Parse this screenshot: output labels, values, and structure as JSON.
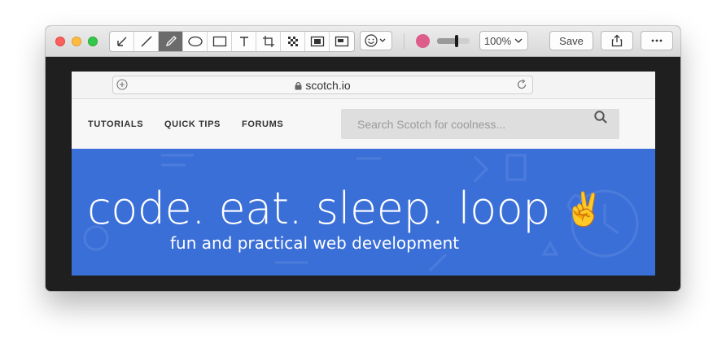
{
  "toolbar": {
    "tools": [
      {
        "name": "arrow-tool",
        "icon": "arrow-icon"
      },
      {
        "name": "line-tool",
        "icon": "line-icon"
      },
      {
        "name": "pen-tool",
        "icon": "pen-icon",
        "active": true
      },
      {
        "name": "ellipse-tool",
        "icon": "ellipse-icon"
      },
      {
        "name": "rectangle-tool",
        "icon": "rectangle-icon"
      },
      {
        "name": "text-tool",
        "icon": "text-icon"
      },
      {
        "name": "crop-tool",
        "icon": "crop-icon"
      },
      {
        "name": "pixelate-tool",
        "icon": "pixelate-icon"
      },
      {
        "name": "highlight-tool",
        "icon": "highlight-icon"
      },
      {
        "name": "magnify-tool",
        "icon": "magnify-icon"
      }
    ],
    "emoji_icon": "smiley-icon",
    "color": "#dc5c8a",
    "stroke_level": 0.6,
    "zoom": "100%",
    "save_label": "Save",
    "share_icon": "share-icon",
    "more_icon": "more-icon"
  },
  "browser": {
    "url": "scotch.io",
    "new_tab_icon": "plus-circle-icon",
    "reload_icon": "reload-icon",
    "lock_icon": "lock-icon"
  },
  "site": {
    "nav": [
      "TUTORIALS",
      "QUICK TIPS",
      "FORUMS"
    ],
    "search_placeholder": "Search Scotch for coolness...",
    "hero_title": "code. eat. sleep. loop",
    "hero_emoji": "✌",
    "hero_subtitle": "fun and practical web development",
    "hero_color": "#3b6fd8"
  }
}
